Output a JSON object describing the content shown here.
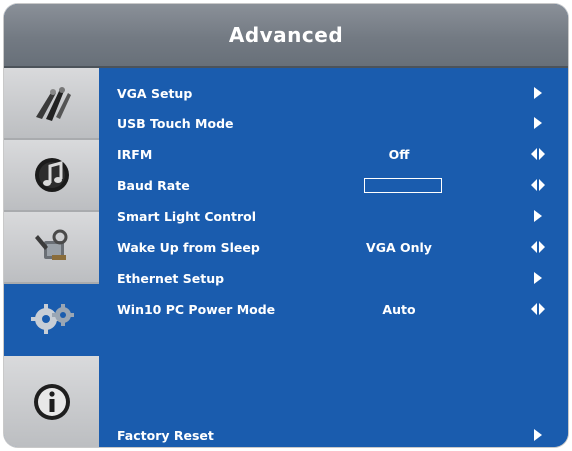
{
  "header": {
    "title": "Advanced"
  },
  "sidebar": {
    "items": [
      {
        "icon": "picture-tools-icon",
        "active": false
      },
      {
        "icon": "audio-icon",
        "active": false
      },
      {
        "icon": "settings-tools-icon",
        "active": false
      },
      {
        "icon": "gears-icon",
        "active": true
      },
      {
        "icon": "info-icon",
        "active": false
      }
    ]
  },
  "menu": {
    "items": [
      {
        "label": "VGA Setup",
        "value": "",
        "control": "arrow-right"
      },
      {
        "label": "USB Touch Mode",
        "value": "",
        "control": "arrow-right"
      },
      {
        "label": "IRFM",
        "value": "Off",
        "control": "arrow-left-right"
      },
      {
        "label": "Baud Rate",
        "value": "",
        "control": "arrow-left-right"
      },
      {
        "label": "Smart Light Control",
        "value": "",
        "control": "arrow-right"
      },
      {
        "label": "Wake Up from Sleep",
        "value": "VGA Only",
        "control": "arrow-left-right"
      },
      {
        "label": "Ethernet Setup",
        "value": "",
        "control": "arrow-right"
      },
      {
        "label": "Win10 PC Power Mode",
        "value": "Auto",
        "control": "arrow-left-right"
      }
    ],
    "footer_item": {
      "label": "Factory Reset",
      "control": "arrow-right"
    }
  },
  "colors": {
    "panel_blue": "#1a5cae",
    "header_gray": "#737a83",
    "sidebar_gray": "#c8c9cb",
    "text": "#ffffff"
  }
}
